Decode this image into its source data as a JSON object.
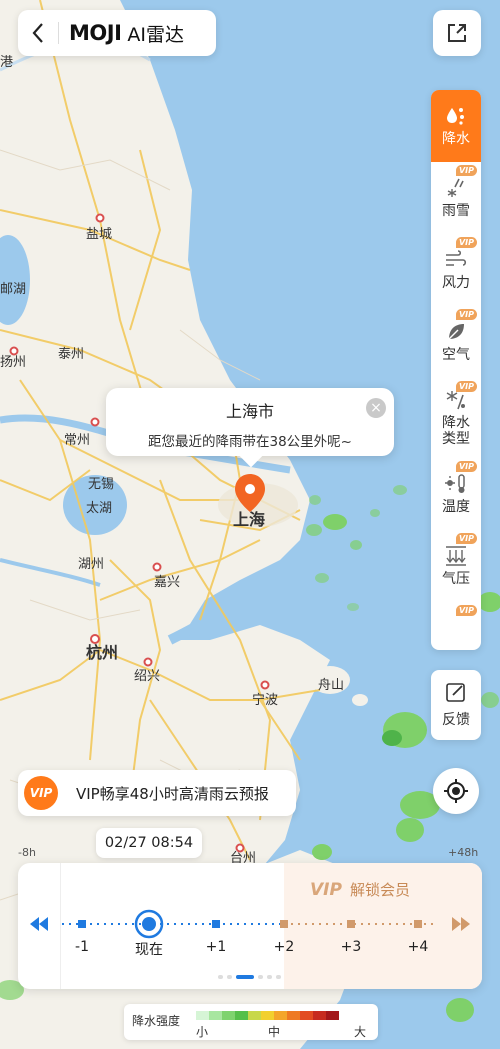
{
  "app": {
    "brand": "MOJI",
    "title": "AI雷达"
  },
  "map_labels": [
    {
      "id": "gang",
      "text": "港"
    },
    {
      "id": "yancheng",
      "text": "盐城"
    },
    {
      "id": "gaoyou",
      "text": "邮湖"
    },
    {
      "id": "yangzhou",
      "text": "扬州"
    },
    {
      "id": "taizhou_n",
      "text": "泰州"
    },
    {
      "id": "changzhou",
      "text": "常州"
    },
    {
      "id": "wuxi",
      "text": "无锡"
    },
    {
      "id": "taihu",
      "text": "太湖"
    },
    {
      "id": "huzhou",
      "text": "湖州"
    },
    {
      "id": "jiaxing",
      "text": "嘉兴"
    },
    {
      "id": "hangzhou",
      "text": "杭州"
    },
    {
      "id": "shaoxing",
      "text": "绍兴"
    },
    {
      "id": "ningbo",
      "text": "宁波"
    },
    {
      "id": "zhoushan",
      "text": "舟山"
    },
    {
      "id": "taizhou_s",
      "text": "台州"
    },
    {
      "id": "shanghai",
      "text": "上海"
    }
  ],
  "popup": {
    "city": "上海市",
    "message": "距您最近的降雨带在38公里外呢~",
    "close": "×"
  },
  "layers": [
    {
      "label": "降水",
      "icon": "precipitation-icon",
      "vip": false,
      "active": true
    },
    {
      "label": "雨雪",
      "icon": "rain-snow-icon",
      "vip": true,
      "active": false
    },
    {
      "label": "风力",
      "icon": "wind-icon",
      "vip": true,
      "active": false
    },
    {
      "label": "空气",
      "icon": "air-icon",
      "vip": true,
      "active": false
    },
    {
      "label": "降水\n类型",
      "icon": "precip-type-icon",
      "vip": true,
      "active": false
    },
    {
      "label": "温度",
      "icon": "temperature-icon",
      "vip": true,
      "active": false
    },
    {
      "label": "气压",
      "icon": "pressure-icon",
      "vip": true,
      "active": false
    }
  ],
  "vip_badge": "VIP",
  "feedback_label": "反馈",
  "promo": {
    "badge": "VIP",
    "text": "VIP畅享48小时高清雨云预报"
  },
  "time": {
    "current": "02/27 08:54",
    "left_edge": "-8h",
    "right_edge": "+48h"
  },
  "timeline": {
    "unlock_mark": "VIP",
    "unlock_label": "解锁会员",
    "ticks": [
      "-1",
      "现在",
      "+1",
      "+2",
      "+3",
      "+4"
    ],
    "current_index": 1
  },
  "legend": {
    "title": "降水强度",
    "low": "小",
    "mid": "中",
    "high": "大",
    "colors": [
      "#d6f5d6",
      "#a8e6a0",
      "#7ed36e",
      "#55bf4a",
      "#c8d84a",
      "#f2d02e",
      "#f4a62a",
      "#ee7a23",
      "#e24c22",
      "#c72b1f",
      "#a3171a"
    ]
  }
}
